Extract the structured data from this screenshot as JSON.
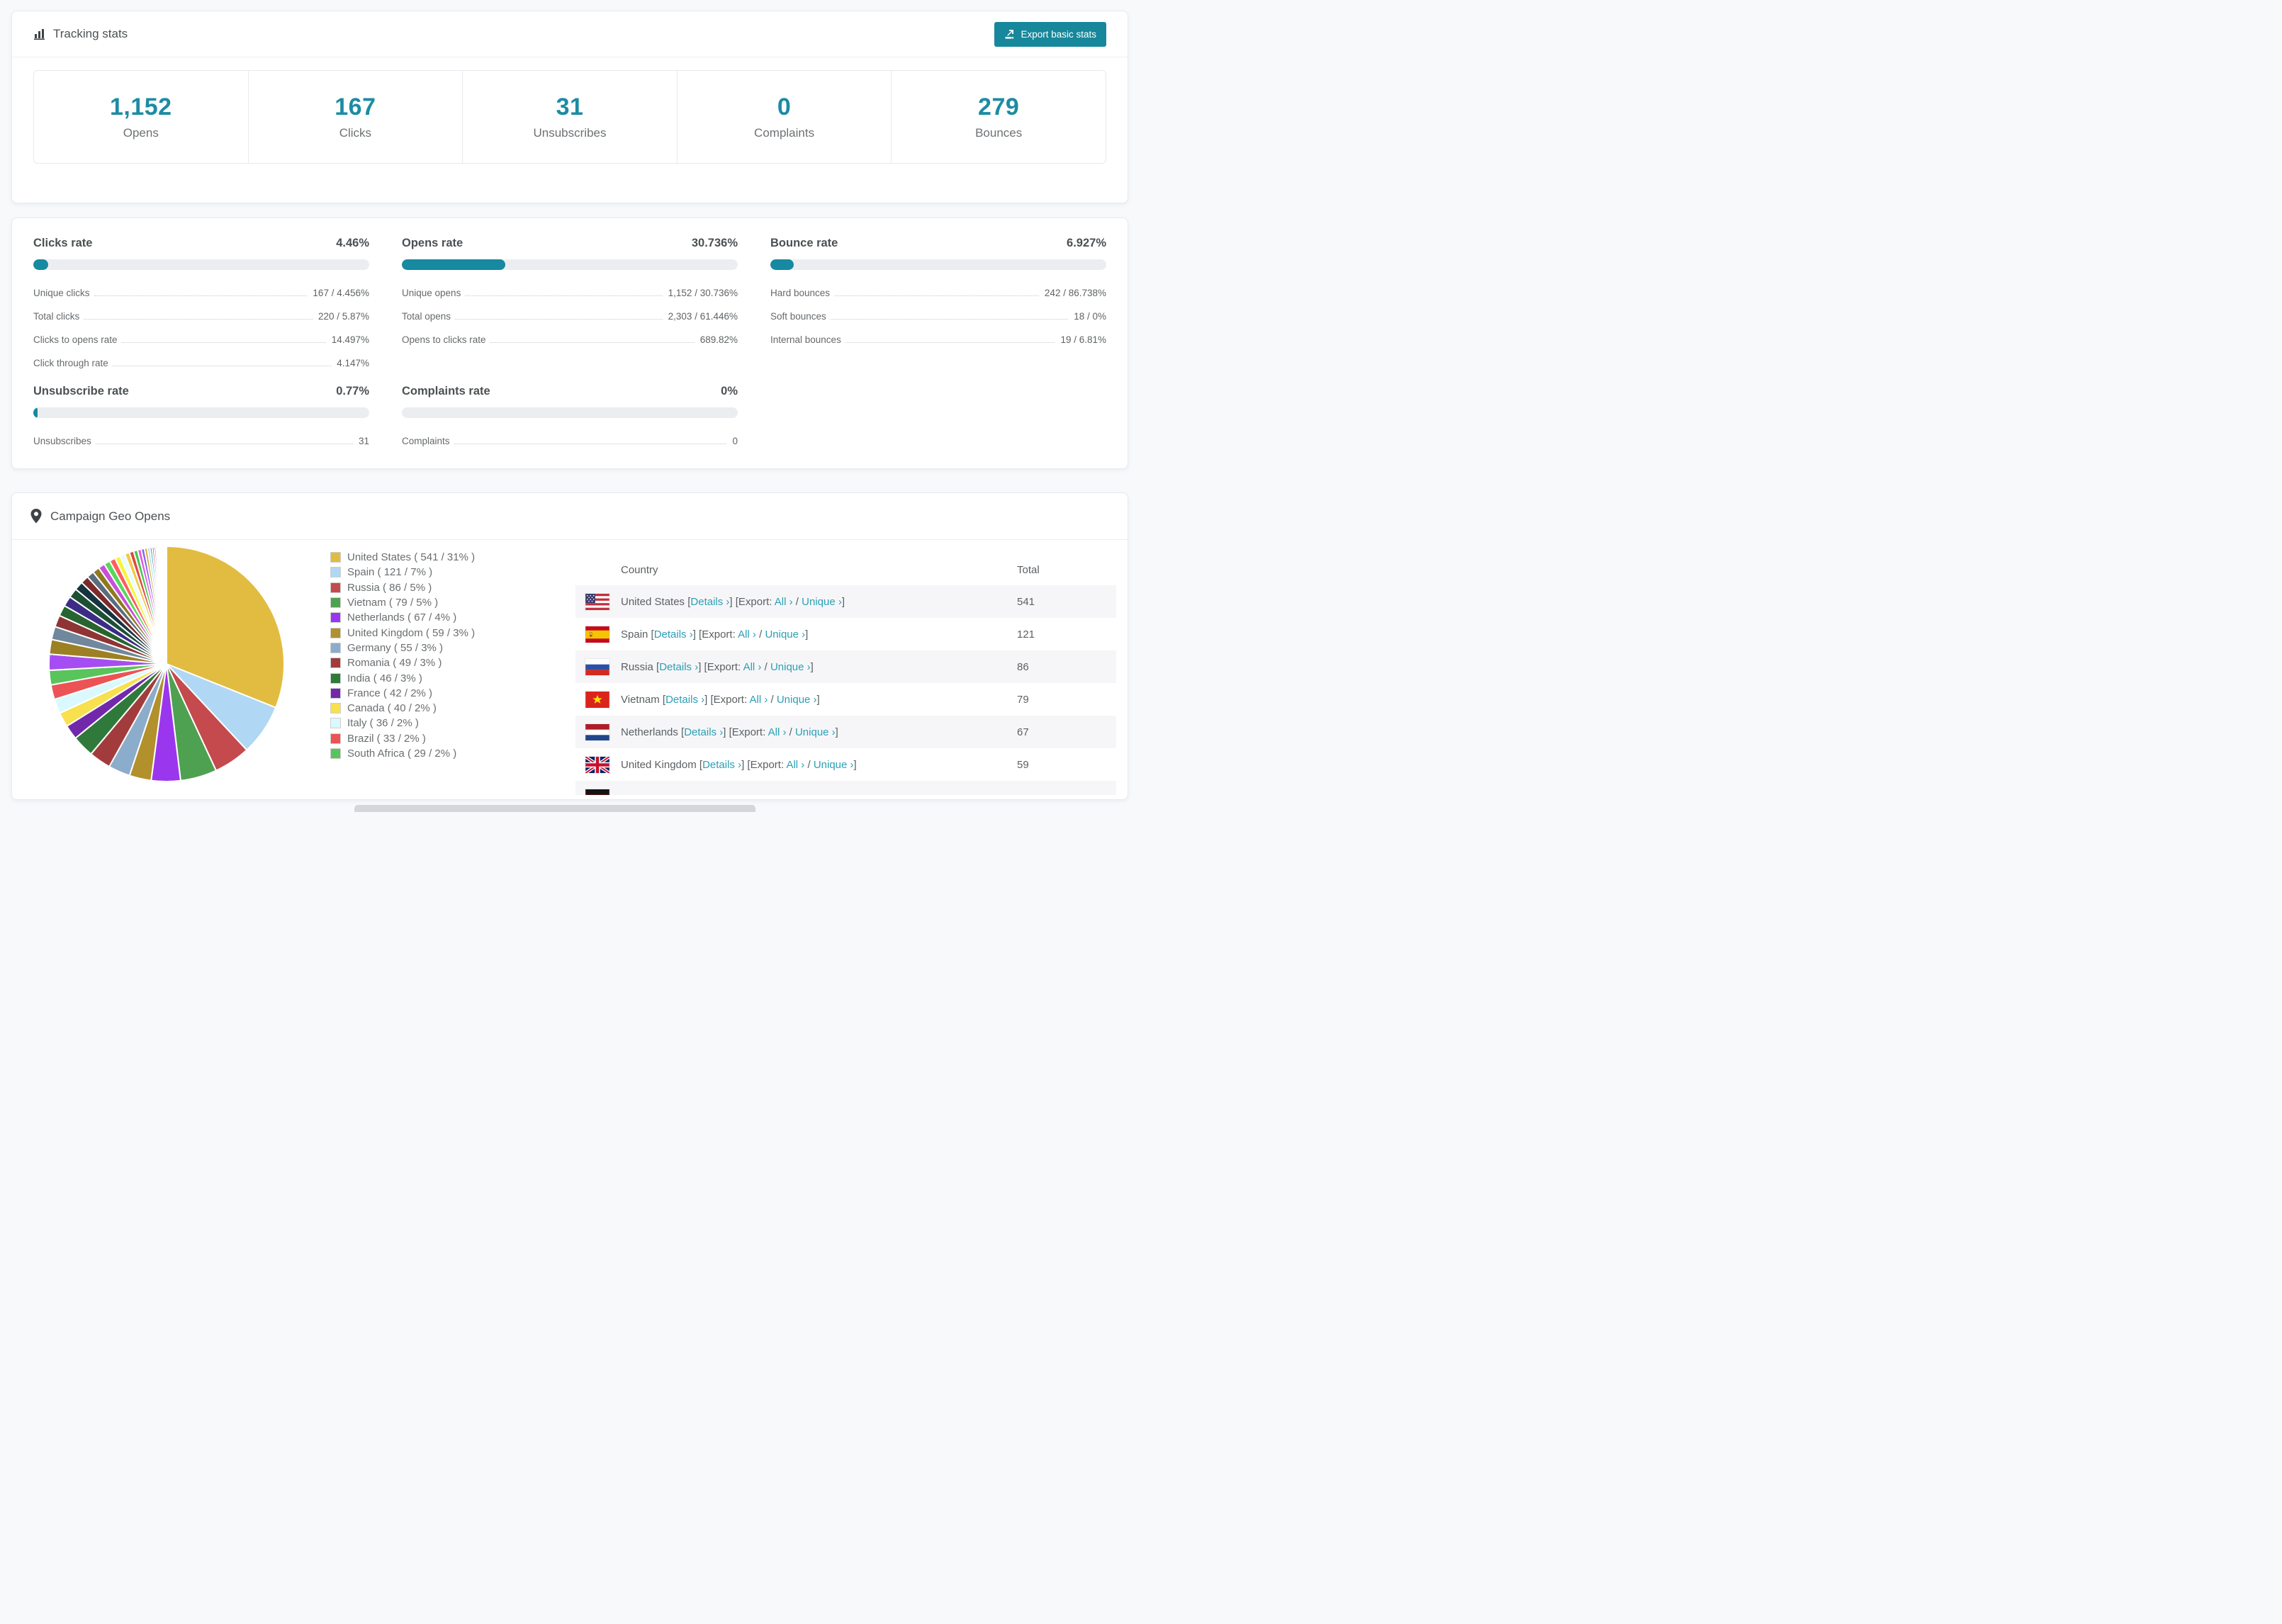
{
  "tracking": {
    "title": "Tracking stats",
    "export_button": "Export basic stats",
    "stats": [
      {
        "value": "1,152",
        "label": "Opens"
      },
      {
        "value": "167",
        "label": "Clicks"
      },
      {
        "value": "31",
        "label": "Unsubscribes"
      },
      {
        "value": "0",
        "label": "Complaints"
      },
      {
        "value": "279",
        "label": "Bounces"
      }
    ]
  },
  "rates": {
    "accent_color": "#1789a0",
    "blocks": [
      {
        "title": "Clicks rate",
        "value": "4.46%",
        "bar_percent": 4.46,
        "rows": [
          [
            "Unique clicks",
            "167 / 4.456%"
          ],
          [
            "Total clicks",
            "220 / 5.87%"
          ],
          [
            "Clicks to opens rate",
            "14.497%"
          ],
          [
            "Click through rate",
            "4.147%"
          ]
        ]
      },
      {
        "title": "Opens rate",
        "value": "30.736%",
        "bar_percent": 30.736,
        "rows": [
          [
            "Unique opens",
            "1,152 / 30.736%"
          ],
          [
            "Total opens",
            "2,303 / 61.446%"
          ],
          [
            "Opens to clicks rate",
            "689.82%"
          ]
        ]
      },
      {
        "title": "Bounce rate",
        "value": "6.927%",
        "bar_percent": 6.927,
        "rows": [
          [
            "Hard bounces",
            "242 / 86.738%"
          ],
          [
            "Soft bounces",
            "18 / 0%"
          ],
          [
            "Internal bounces",
            "19 / 6.81%"
          ]
        ]
      },
      {
        "title": "Unsubscribe rate",
        "value": "0.77%",
        "bar_percent": 0.77,
        "rows": [
          [
            "Unsubscribes",
            "31"
          ]
        ]
      },
      {
        "title": "Complaints rate",
        "value": "0%",
        "bar_percent": 0,
        "rows": [
          [
            "Complaints",
            "0"
          ]
        ]
      }
    ]
  },
  "geo": {
    "title": "Campaign Geo Opens",
    "table": {
      "columns": [
        "Country",
        "Total"
      ],
      "tokens": {
        "open": "[",
        "close": "]",
        "details": "Details ›",
        "export_prefix": "[Export: ",
        "all": "All ›",
        "slash": " / ",
        "unique": "Unique ›"
      },
      "rows": [
        {
          "country": "United States",
          "flag": "us-flag",
          "total": "541"
        },
        {
          "country": "Spain",
          "flag": "es-flag",
          "total": "121"
        },
        {
          "country": "Russia",
          "flag": "ru-flag",
          "total": "86"
        },
        {
          "country": "Vietnam",
          "flag": "vn-flag",
          "total": "79"
        },
        {
          "country": "Netherlands",
          "flag": "nl-flag",
          "total": "67"
        },
        {
          "country": "United Kingdom",
          "flag": "gb-flag",
          "total": "59"
        }
      ],
      "partial_row": {
        "flag": "de-flag"
      }
    }
  },
  "chart_data": {
    "type": "pie",
    "title": "Campaign Geo Opens",
    "legend_position": "right",
    "labels": [
      "United States",
      "Spain",
      "Russia",
      "Vietnam",
      "Netherlands",
      "United Kingdom",
      "Germany",
      "Romania",
      "India",
      "France",
      "Canada",
      "Italy",
      "Brazil",
      "South Africa"
    ],
    "values": [
      541,
      121,
      86,
      79,
      67,
      59,
      55,
      49,
      46,
      42,
      40,
      36,
      33,
      29
    ],
    "percents": [
      31,
      7,
      5,
      5,
      4,
      3,
      3,
      3,
      3,
      2,
      2,
      2,
      2,
      2
    ],
    "colors": [
      "#e2bc40",
      "#b0d7f3",
      "#c44a4d",
      "#4ea151",
      "#9b36ef",
      "#b2902c",
      "#8caccb",
      "#a23c3c",
      "#2f7a3a",
      "#7128ab",
      "#f8e04e",
      "#daf9fe",
      "#ec5355",
      "#58c45b"
    ],
    "legend_labels": [
      "United States ( 541 / 31% )",
      "Spain ( 121 / 7% )",
      "Russia ( 86 / 5% )",
      "Vietnam ( 79 / 5% )",
      "Netherlands ( 67 / 4% )",
      "United Kingdom ( 59 / 3% )",
      "Germany ( 55 / 3% )",
      "Romania ( 49 / 3% )",
      "India ( 46 / 3% )",
      "France ( 42 / 2% )",
      "Canada ( 40 / 2% )",
      "Italy ( 36 / 2% )",
      "Brazil ( 33 / 2% )",
      "South Africa ( 29 / 2% )"
    ],
    "others": {
      "note": "unlabeled small slices completing the circle",
      "values": [
        2.2,
        2.0,
        1.8,
        1.6,
        1.5,
        1.4,
        1.3,
        1.2,
        1.1,
        1.0,
        0.95,
        0.9,
        0.85,
        0.8,
        0.75,
        0.7,
        0.65,
        0.6,
        0.55,
        0.5,
        0.45,
        0.4,
        0.35,
        0.3,
        0.27,
        0.24,
        0.21,
        0.18,
        0.15,
        0.13,
        0.11,
        0.1,
        0.09,
        0.08,
        0.07,
        0.06,
        0.05,
        0.05,
        0.04,
        0.04,
        0.03,
        0.03,
        0.02,
        0.02
      ],
      "colors": [
        "#a54df2",
        "#9c8023",
        "#71879c",
        "#8f3434",
        "#27642f",
        "#3c2c85",
        "#1d4f33",
        "#16343f",
        "#7c2a2a",
        "#5a6c7e",
        "#8e7a1e",
        "#c94fdb",
        "#58d85a",
        "#ff5d5d",
        "#f4f63f",
        "#e9fbff",
        "#f2c94c",
        "#e0483f",
        "#44c74f",
        "#e05ce0",
        "#8a5cf5",
        "#d4af37",
        "#aed5f2",
        "#3aa3a0",
        "#c04848",
        "#9934ee",
        "#b3922b",
        "#8aabc8",
        "#a03b3b",
        "#31783a",
        "#f08080",
        "#66cdaa"
      ]
    }
  }
}
